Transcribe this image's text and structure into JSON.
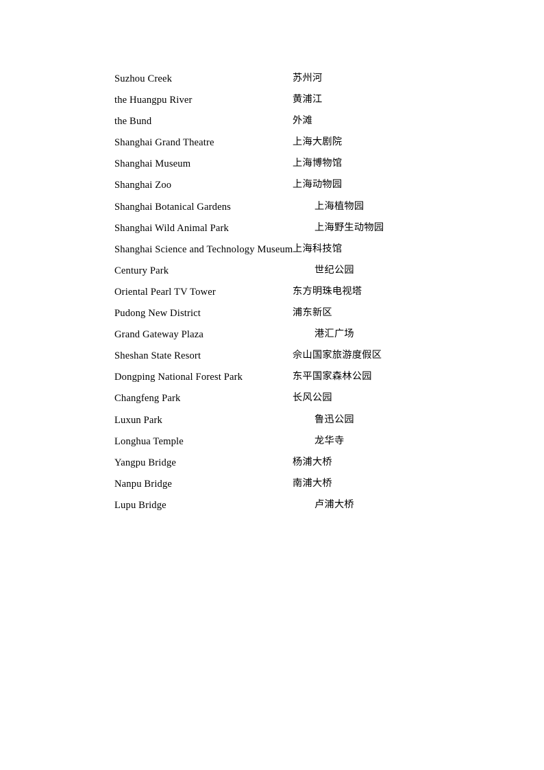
{
  "document": {
    "page_background": "#ffffff",
    "text_color": "#000000",
    "entries": [
      {
        "en": "Suzhou Creek",
        "zh": "苏州河",
        "tab_stop": 1
      },
      {
        "en": "the Huangpu River",
        "zh": "黄浦江",
        "tab_stop": 1
      },
      {
        "en": "the Bund",
        "zh": "外滩",
        "tab_stop": 1
      },
      {
        "en": "Shanghai Grand Theatre",
        "zh": "上海大剧院",
        "tab_stop": 1
      },
      {
        "en": "Shanghai Museum",
        "zh": "上海博物馆",
        "tab_stop": 1
      },
      {
        "en": "Shanghai Zoo",
        "zh": "上海动物园",
        "tab_stop": 1
      },
      {
        "en": "Shanghai Botanical Gardens",
        "zh": "上海植物园",
        "tab_stop": 2
      },
      {
        "en": "Shanghai Wild Animal Park",
        "zh": "上海野生动物园",
        "tab_stop": 2
      },
      {
        "en": "Shanghai Science and Technology Museum",
        "zh": "上海科技馆",
        "tab_stop": 1
      },
      {
        "en": "Century Park",
        "zh": "世纪公园",
        "tab_stop": 2
      },
      {
        "en": "Oriental Pearl TV Tower",
        "zh": "东方明珠电视塔",
        "tab_stop": 1
      },
      {
        "en": "Pudong New District",
        "zh": "浦东新区",
        "tab_stop": 1
      },
      {
        "en": "Grand Gateway Plaza",
        "zh": "港汇广场",
        "tab_stop": 2
      },
      {
        "en": "Sheshan State Resort",
        "zh": "佘山国家旅游度假区",
        "tab_stop": 1
      },
      {
        "en": "Dongping National Forest Park",
        "zh": "东平国家森林公园",
        "tab_stop": 1
      },
      {
        "en": "Changfeng Park",
        "zh": "长风公园",
        "tab_stop": 1
      },
      {
        "en": "Luxun Park",
        "zh": "鲁迅公园",
        "tab_stop": 2
      },
      {
        "en": "Longhua Temple",
        "zh": "龙华寺",
        "tab_stop": 2
      },
      {
        "en": "Yangpu Bridge",
        "zh": "杨浦大桥",
        "tab_stop": 1
      },
      {
        "en": "Nanpu Bridge",
        "zh": "南浦大桥",
        "tab_stop": 1
      },
      {
        "en": "Lupu Bridge",
        "zh": "卢浦大桥",
        "tab_stop": 2
      }
    ]
  }
}
